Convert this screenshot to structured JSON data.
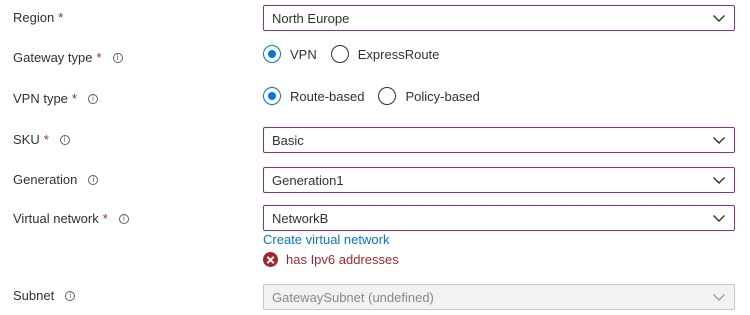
{
  "fields": {
    "region": {
      "label": "Region",
      "value": "North Europe"
    },
    "gateway_type": {
      "label": "Gateway type",
      "options": [
        "VPN",
        "ExpressRoute"
      ],
      "selected": "VPN"
    },
    "vpn_type": {
      "label": "VPN type",
      "options": [
        "Route-based",
        "Policy-based"
      ],
      "selected": "Route-based"
    },
    "sku": {
      "label": "SKU",
      "value": "Basic"
    },
    "generation": {
      "label": "Generation",
      "value": "Generation1"
    },
    "virtual_network": {
      "label": "Virtual network",
      "value": "NetworkB",
      "create_link": "Create virtual network",
      "error": "has Ipv6 addresses"
    },
    "subnet": {
      "label": "Subnet",
      "value": "GatewaySubnet (undefined)",
      "disabled": true
    }
  },
  "required_marker": "*",
  "colors": {
    "focus_border": "#8a2da5",
    "accent": "#0078d4",
    "error": "#a4262c",
    "disabled_bg": "#f3f2f1"
  }
}
